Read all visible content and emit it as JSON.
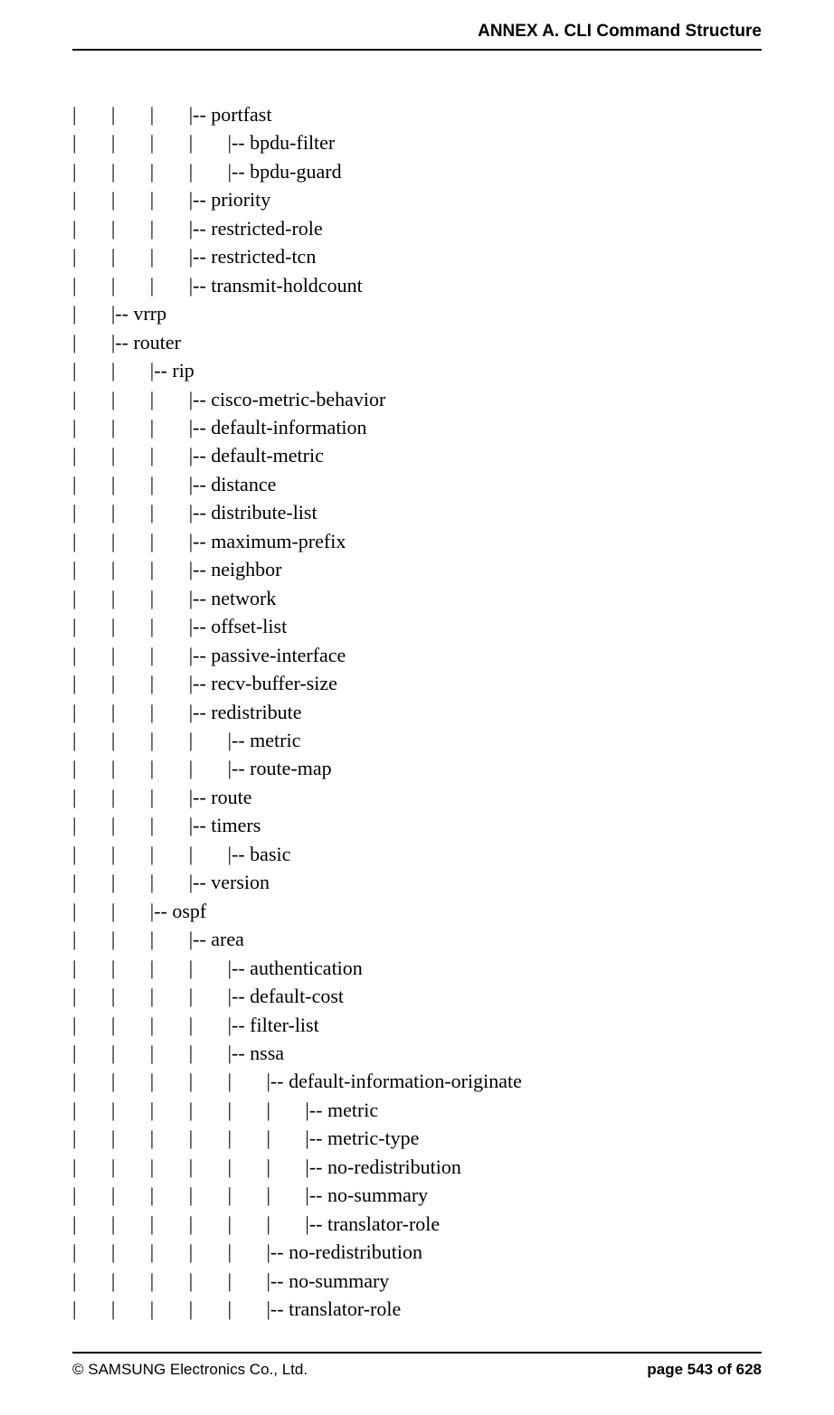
{
  "header": {
    "title": "ANNEX A. CLI Command Structure"
  },
  "footer": {
    "copyright": "© SAMSUNG Electronics Co., Ltd.",
    "page_label": "page 543 of 628"
  },
  "tree": {
    "lines": [
      "|       |       |       |-- portfast",
      "|       |       |       |       |-- bpdu-filter",
      "|       |       |       |       |-- bpdu-guard",
      "|       |       |       |-- priority",
      "|       |       |       |-- restricted-role",
      "|       |       |       |-- restricted-tcn",
      "|       |       |       |-- transmit-holdcount",
      "|       |-- vrrp",
      "|       |-- router",
      "|       |       |-- rip",
      "|       |       |       |-- cisco-metric-behavior",
      "|       |       |       |-- default-information",
      "|       |       |       |-- default-metric",
      "|       |       |       |-- distance",
      "|       |       |       |-- distribute-list",
      "|       |       |       |-- maximum-prefix",
      "|       |       |       |-- neighbor",
      "|       |       |       |-- network",
      "|       |       |       |-- offset-list",
      "|       |       |       |-- passive-interface",
      "|       |       |       |-- recv-buffer-size",
      "|       |       |       |-- redistribute",
      "|       |       |       |       |-- metric",
      "|       |       |       |       |-- route-map",
      "|       |       |       |-- route",
      "|       |       |       |-- timers",
      "|       |       |       |       |-- basic",
      "|       |       |       |-- version",
      "|       |       |-- ospf",
      "|       |       |       |-- area",
      "|       |       |       |       |-- authentication",
      "|       |       |       |       |-- default-cost",
      "|       |       |       |       |-- filter-list",
      "|       |       |       |       |-- nssa",
      "|       |       |       |       |       |-- default-information-originate",
      "|       |       |       |       |       |       |-- metric",
      "|       |       |       |       |       |       |-- metric-type",
      "|       |       |       |       |       |       |-- no-redistribution",
      "|       |       |       |       |       |       |-- no-summary",
      "|       |       |       |       |       |       |-- translator-role",
      "|       |       |       |       |       |-- no-redistribution",
      "|       |       |       |       |       |-- no-summary",
      "|       |       |       |       |       |-- translator-role"
    ]
  }
}
